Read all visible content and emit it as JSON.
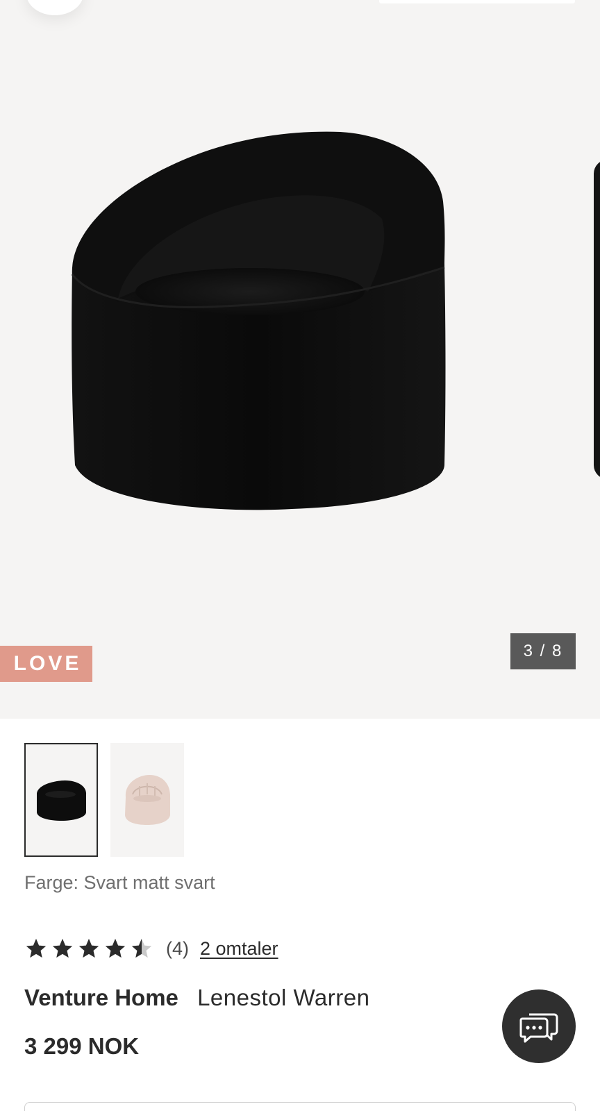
{
  "gallery": {
    "badge": "LOVE",
    "counter": "3 / 8",
    "current_index": 3,
    "total_images": 8
  },
  "variants": [
    {
      "name": "Svart matt svart",
      "selected": true,
      "swatch": "#111111"
    },
    {
      "name": "Beige",
      "selected": false,
      "swatch": "#e6d2c9"
    }
  ],
  "color_line": "Farge: Svart matt svart",
  "rating": {
    "stars": 4.5,
    "max_stars": 5,
    "count_text": "(4)",
    "reviews_link": "2 omtaler"
  },
  "product": {
    "brand": "Venture Home",
    "name": "Lenestol Warren",
    "price": "3 299 NOK"
  },
  "colors": {
    "badge": "#e09a8b",
    "counter_bg": "#595959",
    "gallery_bg": "#f5f4f3",
    "chat_bg": "#2f2f2f",
    "text": "#2b2b2b"
  },
  "icons": {
    "chat": "chat-bubbles-icon",
    "back": "back-button"
  }
}
